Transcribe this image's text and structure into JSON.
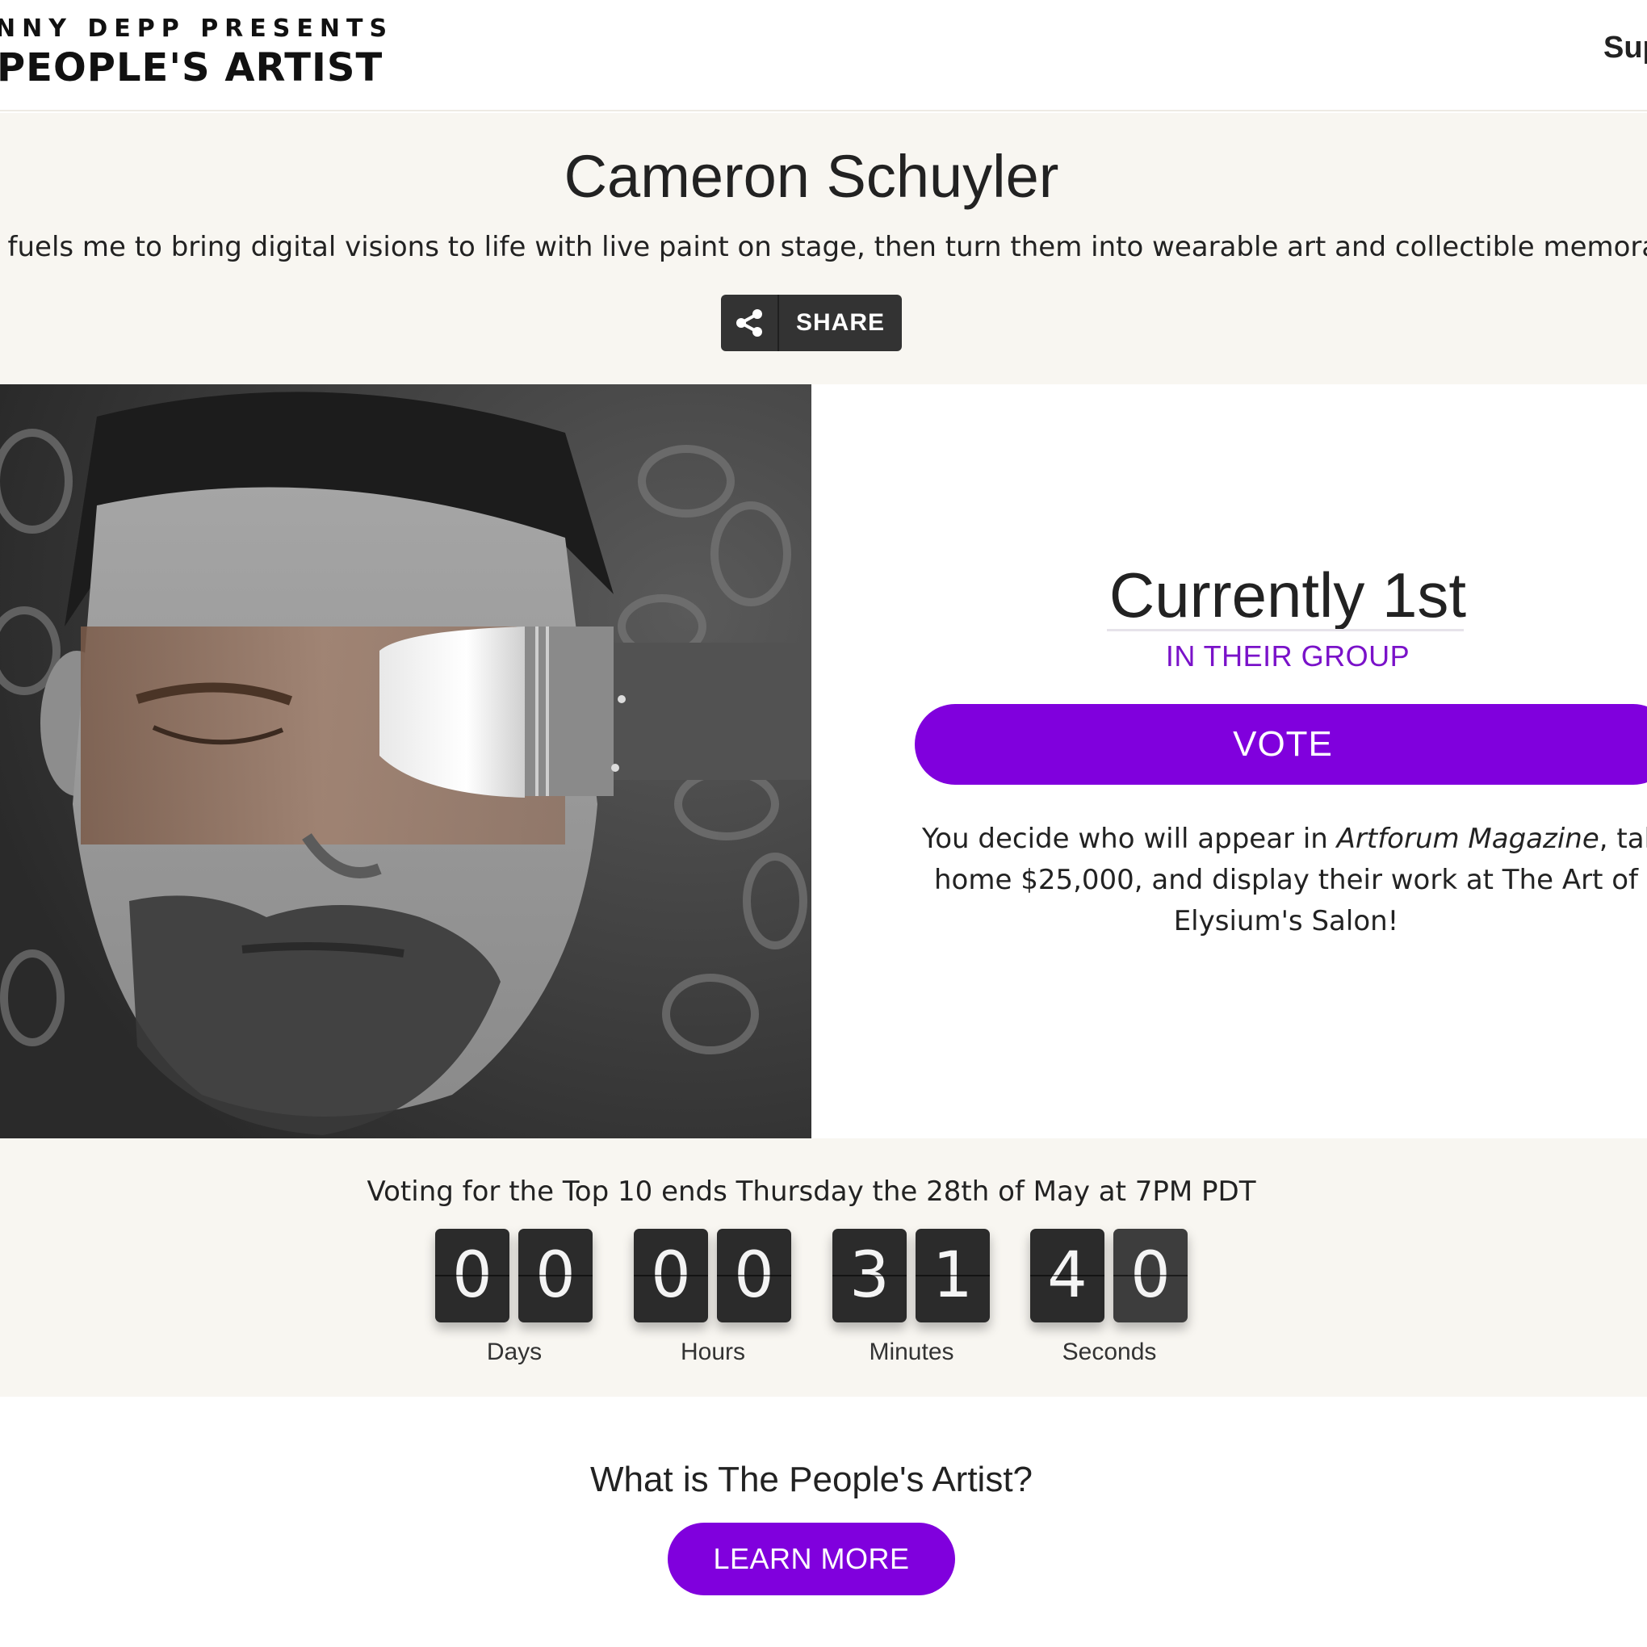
{
  "header": {
    "brand_top": "NNY DEPP PRESENTS",
    "brand_main_prefix": "PEOPLE'S ",
    "brand_main_suffix": "ARTIST",
    "nav_link": "Sup"
  },
  "artist": {
    "name": "Cameron Schuyler",
    "bio": "c fuels me to bring digital visions to life with live paint on stage, then turn them into wearable art and collectible memorabi"
  },
  "share": {
    "label": "SHARE",
    "icon": "share-icon"
  },
  "ranking": {
    "position": "Currently 1st",
    "subtitle": "IN THEIR GROUP"
  },
  "vote": {
    "label": "VOTE",
    "blurb": {
      "line1_pre": "You decide who will appear in ",
      "line1_italic": "Artforum Magazine",
      "line1_post": ", take",
      "line2": "home $25,000, and display their work at The Art of",
      "line3": "Elysium's Salon!"
    }
  },
  "countdown": {
    "deadline": "Voting for the Top 10 ends Thursday the 28th of May at 7PM PDT",
    "units": [
      {
        "label": "Days",
        "digits": [
          "0",
          "0"
        ]
      },
      {
        "label": "Hours",
        "digits": [
          "0",
          "0"
        ]
      },
      {
        "label": "Minutes",
        "digits": [
          "3",
          "1"
        ]
      },
      {
        "label": "Seconds",
        "digits": [
          "4",
          "0"
        ]
      }
    ]
  },
  "about": {
    "title": "What is The People's Artist?",
    "button_label": "LEARN MORE"
  },
  "colors": {
    "accent_purple": "#8000dd",
    "subtitle_purple": "#7a12c9",
    "band_background": "#f8f6f1",
    "share_button": "#333333"
  }
}
